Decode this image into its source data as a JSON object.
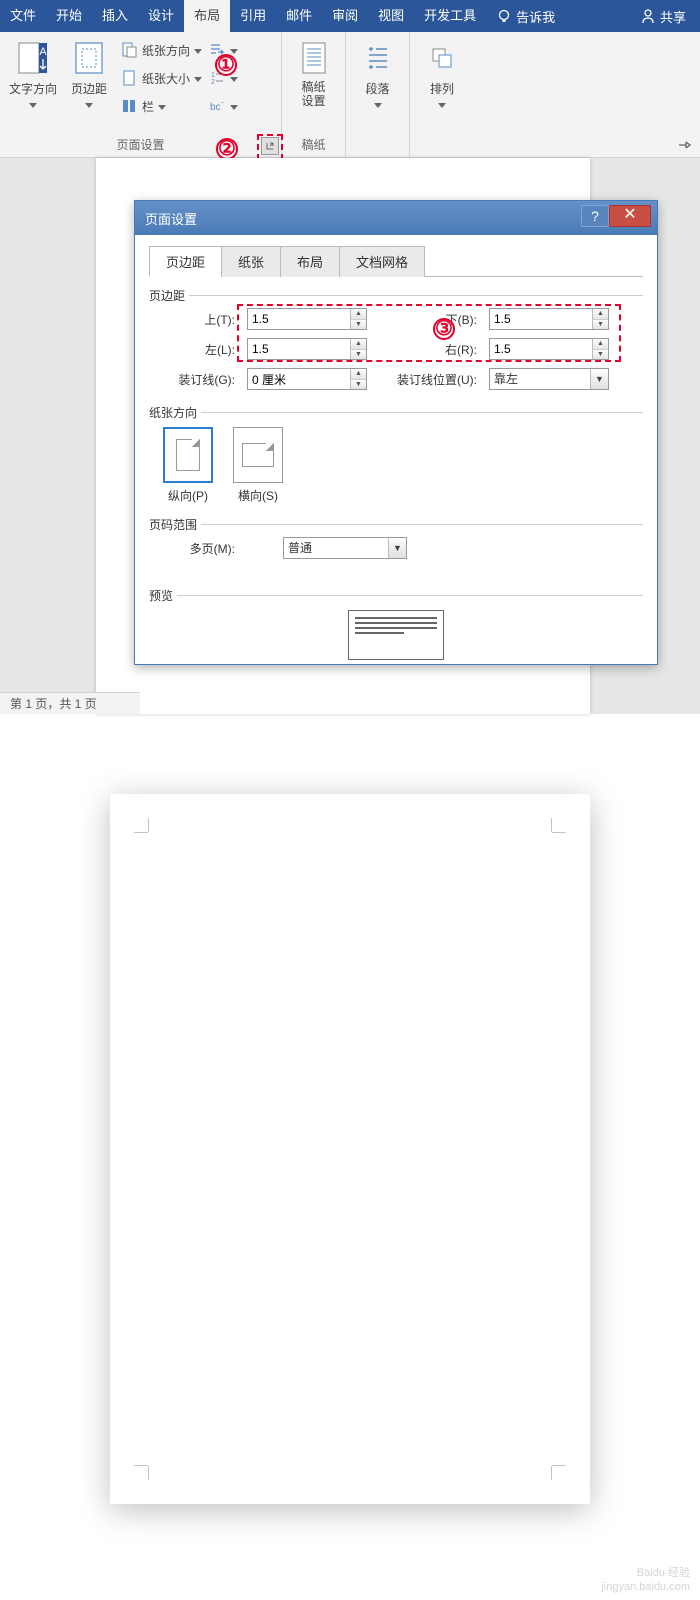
{
  "menu": {
    "file": "文件",
    "home": "开始",
    "insert": "插入",
    "design": "设计",
    "layout": "布局",
    "ref": "引用",
    "mail": "邮件",
    "review": "审阅",
    "view": "视图",
    "dev": "开发工具",
    "tell": "告诉我",
    "share": "共享"
  },
  "ribbon": {
    "textdir": "文字方向",
    "margins": "页边距",
    "orient": "纸张方向",
    "size": "纸张大小",
    "columns": "栏",
    "group_pagesetup": "页面设置",
    "manuscript": "稿纸\n设置",
    "group_manuscript": "稿纸",
    "paragraph": "段落",
    "arrange": "排列"
  },
  "annot": {
    "n1": "①",
    "n2": "②",
    "n3": "③"
  },
  "status": "第 1 页，共 1 页",
  "dialog": {
    "title": "页面设置",
    "tabs": {
      "margins": "页边距",
      "paper": "纸张",
      "layout": "布局",
      "grid": "文档网格"
    },
    "sec_margins": "页边距",
    "top": "上(T):",
    "bottom": "下(B):",
    "left": "左(L):",
    "right": "右(R):",
    "gutter": "装订线(G):",
    "gutterpos": "装订线位置(U):",
    "v_top": "1.5",
    "v_bottom": "1.5",
    "v_left": "1.5",
    "v_right": "1.5",
    "v_gutter": "0 厘米",
    "v_gutterpos": "靠左",
    "sec_orient": "纸张方向",
    "portrait": "纵向(P)",
    "landscape": "横向(S)",
    "sec_range": "页码范围",
    "multi": "多页(M):",
    "v_multi": "普通",
    "sec_preview": "预览"
  },
  "watermark": {
    "l1": "Baidu 经验",
    "l2": "jingyan.baidu.com"
  }
}
